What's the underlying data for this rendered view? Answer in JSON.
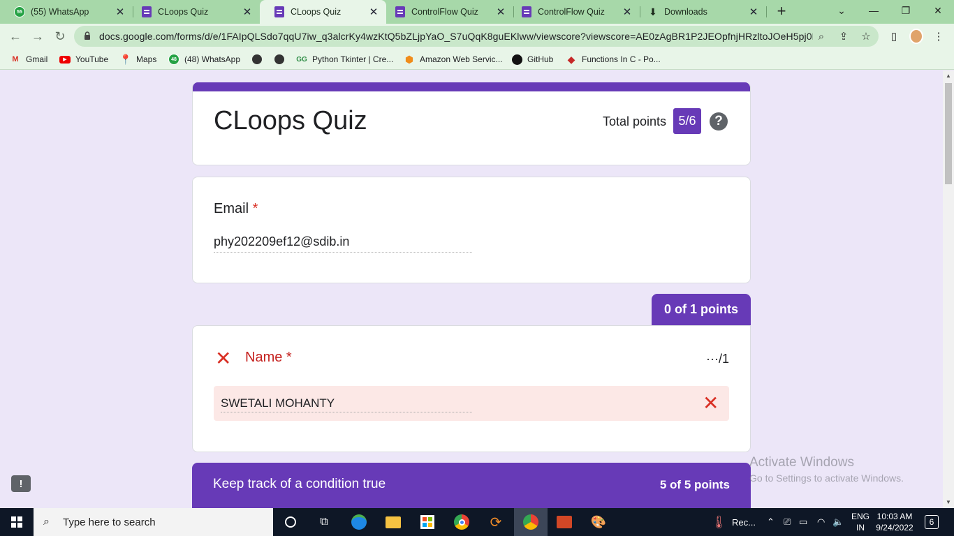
{
  "browser": {
    "tabs": [
      {
        "label": "(55) WhatsApp",
        "favicon": "whatsapp-icon",
        "badge": "55"
      },
      {
        "label": "CLoops Quiz",
        "favicon": "google-forms-icon"
      },
      {
        "label": "CLoops Quiz",
        "favicon": "google-forms-icon",
        "active": true
      },
      {
        "label": "ControlFlow Quiz",
        "favicon": "google-forms-icon"
      },
      {
        "label": "ControlFlow Quiz",
        "favicon": "google-forms-icon"
      },
      {
        "label": "Downloads",
        "favicon": "download-icon"
      }
    ],
    "url": "docs.google.com/forms/d/e/1FAIpQLSdo7qqU7iw_q3alcrKy4wzKtQ5bZLjpYaO_S7uQqK8guEKlww/viewscore?viewscore=AE0zAgBR1P2JEOpfnjHRzltoJOeH5pj0PfYY...",
    "bookmarks": [
      {
        "label": "Gmail",
        "icon": "gmail-icon"
      },
      {
        "label": "YouTube",
        "icon": "youtube-icon"
      },
      {
        "label": "Maps",
        "icon": "maps-icon"
      },
      {
        "label": "(48) WhatsApp",
        "icon": "whatsapp-icon",
        "badge": "48"
      },
      {
        "label": "",
        "icon": "globe-icon"
      },
      {
        "label": "",
        "icon": "globe-icon"
      },
      {
        "label": "Python Tkinter | Cre...",
        "icon": "geeksforgeeks-icon"
      },
      {
        "label": "Amazon Web Servic...",
        "icon": "aws-icon"
      },
      {
        "label": "GitHub",
        "icon": "github-icon"
      },
      {
        "label": "Functions In C - Po...",
        "icon": "diamond-icon"
      }
    ],
    "accent_color": "#a7d8a9"
  },
  "form": {
    "title": "CLoops Quiz",
    "total_label": "Total points",
    "total_score": "5/6",
    "brand_color": "#673ab7",
    "email_question": {
      "label": "Email",
      "required_mark": "*",
      "answer": "phy202209ef12@sdib.in"
    },
    "name_question": {
      "points_tab": "0 of 1 points",
      "label": "Name",
      "required_mark": "*",
      "score": "···/1",
      "answer": "SWETALI MOHANTY",
      "status": "incorrect",
      "error_color": "#d93025"
    },
    "section": {
      "title": "Keep track of a condition true",
      "points": "5 of 5 points"
    }
  },
  "watermark": {
    "line1": "Activate Windows",
    "line2": "Go to Settings to activate Windows."
  },
  "taskbar": {
    "search_placeholder": "Type here to search",
    "tray_app_label": "Rec...",
    "language": "ENG",
    "region": "IN",
    "time": "10:03 AM",
    "date": "9/24/2022",
    "notification_count": "6"
  }
}
